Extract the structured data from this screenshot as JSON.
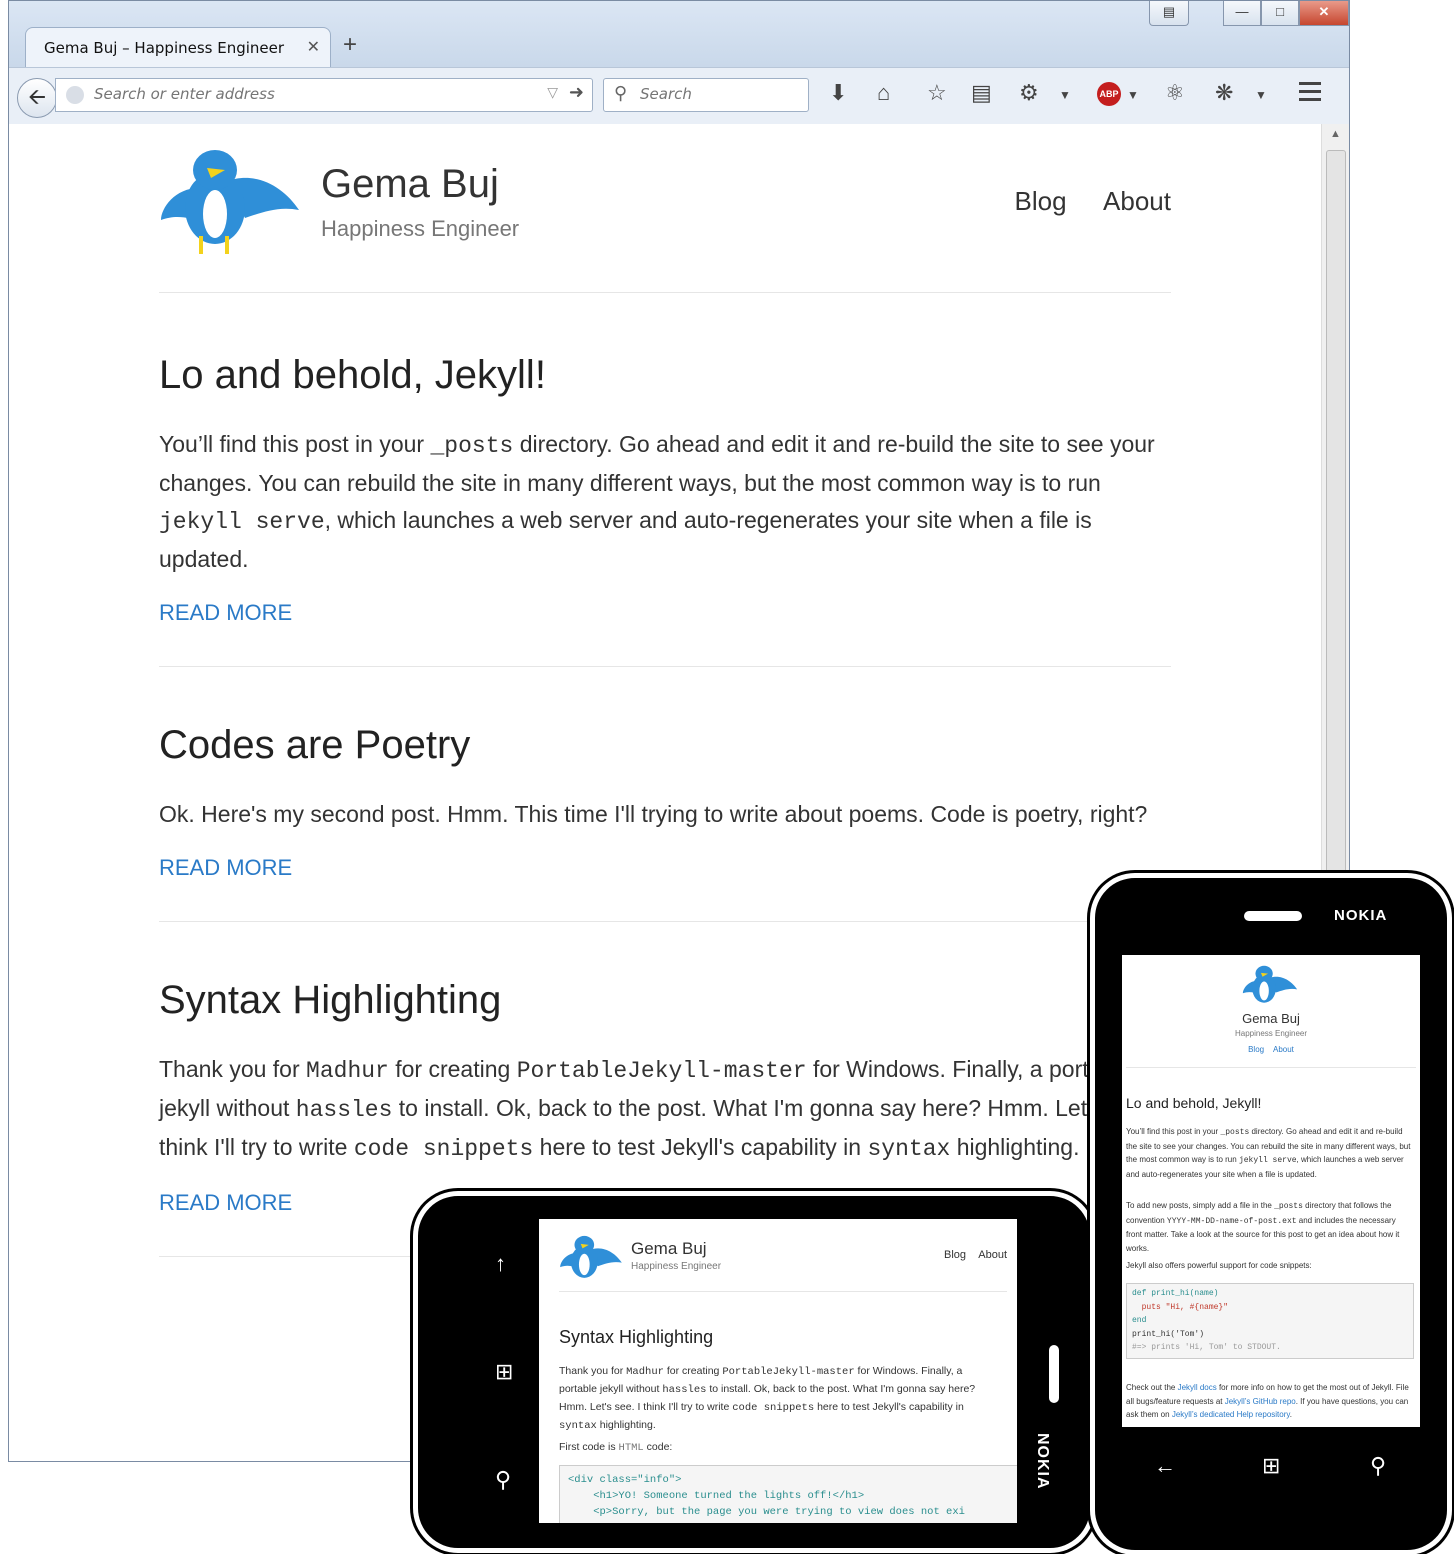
{
  "browser": {
    "tab_title": "Gema Buj – Happiness Engineer",
    "tab_close": "✕",
    "new_tab": "+",
    "url_placeholder": "Search or enter address",
    "search_placeholder": "Search"
  },
  "site": {
    "title": "Gema Buj",
    "tagline": "Happiness Engineer",
    "nav": [
      "Blog",
      "About"
    ]
  },
  "posts": [
    {
      "title": "Lo and behold, Jekyll!",
      "body": {
        "t1": "You’ll find this post in your ",
        "c1": "_posts",
        "t2": " directory. Go ahead and edit it and re-build the site to see your changes. You can rebuild the site in many different ways, but the most common way is to run ",
        "c2": "jekyll serve",
        "t3": ", which launches a web server and auto-regenerates your site when a file is updated."
      },
      "read_more": "READ MORE"
    },
    {
      "title": "Codes are Poetry",
      "body": "Ok. Here's my second post. Hmm. This time I'll trying to write about poems. Code is poetry, right?",
      "read_more": "READ MORE"
    },
    {
      "title": "Syntax Highlighting",
      "body": {
        "t1": "Thank you for ",
        "c1": "Madhur",
        "t2": " for creating ",
        "c2": "PortableJekyll-master",
        "t3": " for Windows. Finally, a portable jekyll without ",
        "c3": "hassles",
        "t4": " to install. Ok, back to the post. What I'm gonna say here? Hmm. Let's see. I think I'll try to write ",
        "c4": "code snippets",
        "t5": " here to test Jekyll's capability in ",
        "c5": "syntax",
        "t6": " highlighting."
      },
      "read_more": "READ MORE"
    }
  ],
  "landscape_phone": {
    "first_code_label": "First code is ",
    "first_code_word": "HTML",
    "first_code_suffix": " code:",
    "code_lines": [
      "<div class=\"info\">",
      "    <h1>YO! Someone turned the lights off!</h1>",
      "    <p>Sorry, but the page you were trying to view does not exi"
    ],
    "brand": "NOKIA"
  },
  "portrait_phone": {
    "brand": "NOKIA",
    "para2": {
      "t1": "To add new posts, simply add a file in the ",
      "c1": "_posts",
      "t2": " directory that follows the convention ",
      "c2": "YYYY-MM-DD-name-of-post.ext",
      "t3": " and includes the necessary front matter. Take a look at the source for this post to get an idea about how it works."
    },
    "para3": "Jekyll also offers powerful support for code snippets:",
    "code_lines": [
      "def print_hi(name)",
      "  puts \"Hi, #{name}\"",
      "end",
      "print_hi('Tom')",
      "#=> prints 'Hi, Tom' to STDOUT."
    ],
    "para4": {
      "t1": "Check out the ",
      "l1": "Jekyll docs",
      "t2": " for more info on how to get the most out of Jekyll. File all bugs/feature requests at ",
      "l2": "Jekyll’s GitHub repo",
      "t3": ". If you have questions, you can ask them on ",
      "l3": "Jekyll’s dedicated Help repository",
      "t4": "."
    }
  },
  "colors": {
    "link": "#2a7ac7",
    "bird_body": "#2f8fd8",
    "beak": "#f3d21c"
  }
}
